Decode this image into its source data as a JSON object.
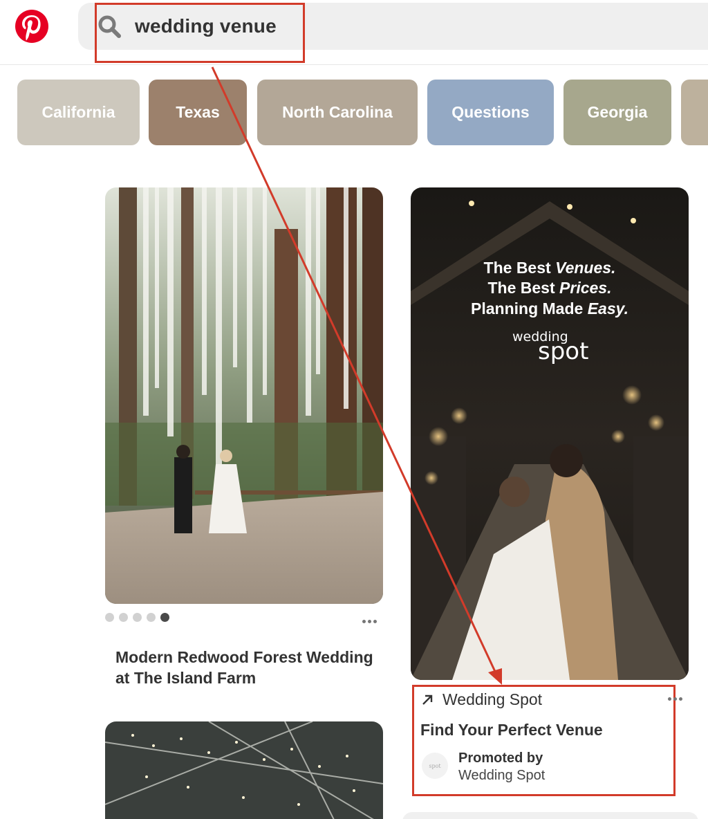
{
  "header": {
    "logo": "pinterest-logo",
    "search": {
      "value": "wedding venue",
      "icon": "search-icon"
    }
  },
  "chips": [
    {
      "label": "California",
      "color": "#cdc8bd"
    },
    {
      "label": "Texas",
      "color": "#9c816c"
    },
    {
      "label": "North Carolina",
      "color": "#b3a797"
    },
    {
      "label": "Questions",
      "color": "#94a9c4"
    },
    {
      "label": "Georgia",
      "color": "#a7a78d"
    },
    {
      "label": "",
      "color": "#bdb19d"
    }
  ],
  "pins": [
    {
      "title": "Modern Redwood Forest Wedding at The Island Farm",
      "carousel": {
        "total": 5,
        "active": 5
      }
    },
    {
      "overlay": {
        "line1_pre": "The Best ",
        "line1_em": "Venues.",
        "line2_pre": "The Best ",
        "line2_em": "Prices.",
        "line3_pre": "Planning Made ",
        "line3_em": "Easy.",
        "brand_top": "wedding",
        "brand_bottom": "spot"
      },
      "domain": "Wedding Spot",
      "title": "Find Your Perfect Venue",
      "promoted_label": "Promoted by",
      "promoter": "Wedding Spot",
      "avatar_text": "spot"
    }
  ],
  "annotation": {
    "color": "#d23b2a"
  }
}
